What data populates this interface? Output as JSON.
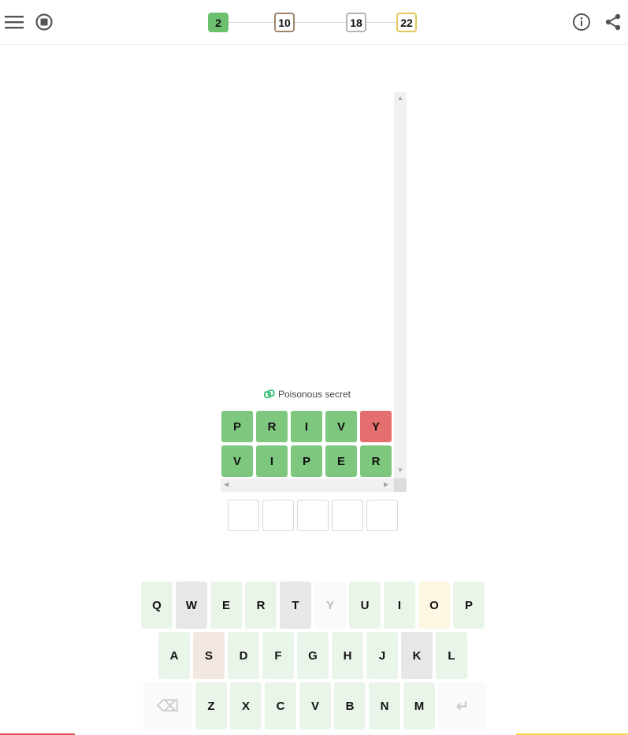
{
  "header": {
    "milestones": [
      {
        "label": "2",
        "bg": "#6cc06e",
        "border": "#6cc06e"
      },
      {
        "label": "10",
        "bg": "#ffffff",
        "border": "#a0856b"
      },
      {
        "label": "18",
        "bg": "#ffffff",
        "border": "#b3b3b3"
      },
      {
        "label": "22",
        "bg": "#ffffff",
        "border": "#e4c75a"
      }
    ],
    "icons": {
      "menu": "hamburger-menu-icon",
      "stop": "stop-icon",
      "info": "info-icon",
      "share": "share-icon"
    }
  },
  "board": {
    "clue": "Poisonous secret",
    "clue_icon": "link-icon",
    "guesses": [
      {
        "letters": [
          "P",
          "R",
          "I",
          "V",
          "Y"
        ],
        "states": [
          "correct",
          "correct",
          "correct",
          "correct",
          "absent"
        ]
      },
      {
        "letters": [
          "V",
          "I",
          "P",
          "E",
          "R"
        ],
        "states": [
          "correct",
          "correct",
          "correct",
          "correct",
          "correct"
        ]
      }
    ],
    "current_input": [
      "",
      "",
      "",
      "",
      ""
    ]
  },
  "keyboard": {
    "rows": [
      [
        {
          "key": "Q",
          "state": "used"
        },
        {
          "key": "W",
          "state": "gray"
        },
        {
          "key": "E",
          "state": "used"
        },
        {
          "key": "R",
          "state": "used"
        },
        {
          "key": "T",
          "state": "gray"
        },
        {
          "key": "Y",
          "state": "faded"
        },
        {
          "key": "U",
          "state": "used"
        },
        {
          "key": "I",
          "state": "used"
        },
        {
          "key": "O",
          "state": "cream"
        },
        {
          "key": "P",
          "state": "used"
        }
      ],
      [
        {
          "key": "A",
          "state": "used"
        },
        {
          "key": "S",
          "state": "pinkish"
        },
        {
          "key": "D",
          "state": "used"
        },
        {
          "key": "F",
          "state": "used"
        },
        {
          "key": "G",
          "state": "used"
        },
        {
          "key": "H",
          "state": "used"
        },
        {
          "key": "J",
          "state": "used"
        },
        {
          "key": "K",
          "state": "gray"
        },
        {
          "key": "L",
          "state": "used"
        }
      ],
      [
        {
          "key": "⌫",
          "state": "wide",
          "name": "backspace-key"
        },
        {
          "key": "Z",
          "state": "used"
        },
        {
          "key": "X",
          "state": "used"
        },
        {
          "key": "C",
          "state": "used"
        },
        {
          "key": "V",
          "state": "used"
        },
        {
          "key": "B",
          "state": "used"
        },
        {
          "key": "N",
          "state": "used"
        },
        {
          "key": "M",
          "state": "used"
        },
        {
          "key": "↵",
          "state": "wide",
          "name": "enter-key"
        }
      ]
    ]
  }
}
